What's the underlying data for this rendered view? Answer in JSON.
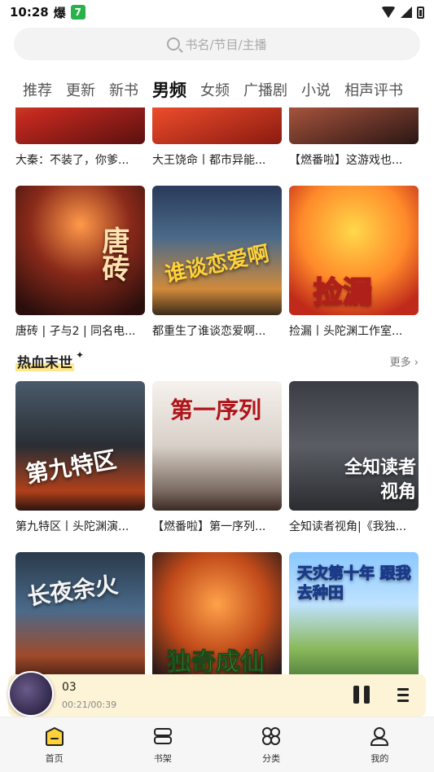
{
  "status_bar": {
    "time": "10:28",
    "app_glyph": "爆",
    "green_badge": "7"
  },
  "search": {
    "placeholder": "书名/节目/主播"
  },
  "tabs": [
    {
      "label": "推荐",
      "active": false
    },
    {
      "label": "更新",
      "active": false
    },
    {
      "label": "新书",
      "active": false
    },
    {
      "label": "男频",
      "active": true
    },
    {
      "label": "女频",
      "active": false
    },
    {
      "label": "广播剧",
      "active": false
    },
    {
      "label": "小说",
      "active": false
    },
    {
      "label": "相声评书",
      "active": false
    }
  ],
  "row0": [
    {
      "title": "大秦：不装了，你爹..."
    },
    {
      "title": "大王饶命丨都市异能..."
    },
    {
      "title": "【燃番啦】这游戏也..."
    }
  ],
  "row1": [
    {
      "title": "唐砖 | 孑与2 | 同名电...",
      "cover_text": "唐砖"
    },
    {
      "title": "都重生了谁谈恋爱啊...",
      "cover_text": "谁谈恋爱啊"
    },
    {
      "title": "捡漏丨头陀渊工作室...",
      "cover_text": "捡漏"
    }
  ],
  "section": {
    "title": "热血末世",
    "more": "更多 ›"
  },
  "row2": [
    {
      "title": "第九特区丨头陀渊演...",
      "cover_text": "第九特区"
    },
    {
      "title": "【燃番啦】第一序列...",
      "cover_text": "第一序列"
    },
    {
      "title": "全知读者视角|《我独...",
      "cover_text": "全知读者视角"
    }
  ],
  "row3": [
    {
      "cover_text": "长夜余火"
    },
    {
      "cover_text": "独奇成仙"
    },
    {
      "cover_text": "天灾第十年 跟我去种田"
    }
  ],
  "player": {
    "title": "03",
    "time": "00:21/00:39"
  },
  "bottom_nav": [
    {
      "label": "首页",
      "icon": "home-icon"
    },
    {
      "label": "书架",
      "icon": "bookshelf-icon"
    },
    {
      "label": "分类",
      "icon": "category-icon"
    },
    {
      "label": "我的",
      "icon": "profile-icon"
    }
  ]
}
